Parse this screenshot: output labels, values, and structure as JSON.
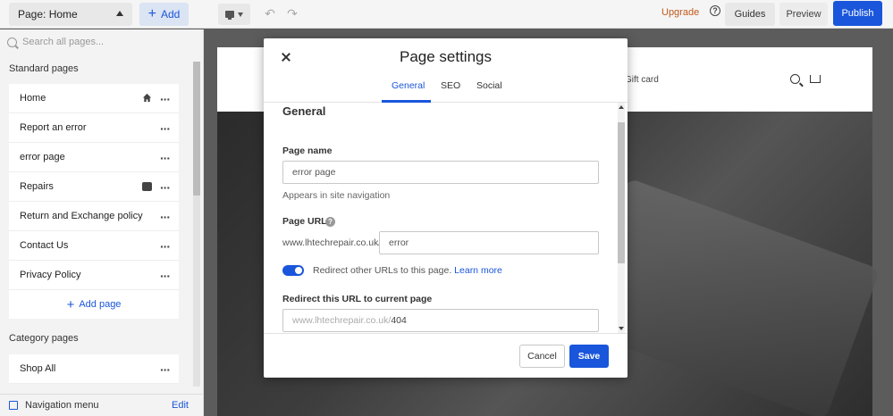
{
  "topbar": {
    "page_select": "Page: Home",
    "add_label": "Add",
    "upgrade": "Upgrade",
    "guides": "Guides",
    "preview": "Preview",
    "publish": "Publish"
  },
  "sidebar": {
    "search_placeholder": "Search all pages...",
    "standard_title": "Standard pages",
    "pages": [
      {
        "label": "Home",
        "icon": "home-icon"
      },
      {
        "label": "Report an error"
      },
      {
        "label": "error page"
      },
      {
        "label": "Repairs",
        "icon": "lock-icon"
      },
      {
        "label": "Return and Exchange policy"
      },
      {
        "label": "Contact Us"
      },
      {
        "label": "Privacy Policy"
      }
    ],
    "add_page": "Add page",
    "category_title": "Category pages",
    "category_pages": [
      {
        "label": "Shop All"
      }
    ],
    "nav_menu": "Navigation menu",
    "edit": "Edit"
  },
  "canvas": {
    "giftcard": "Gift card"
  },
  "modal": {
    "title": "Page settings",
    "tabs": [
      "General",
      "SEO",
      "Social"
    ],
    "active_tab": "General",
    "section": "General",
    "page_name_label": "Page name",
    "page_name_value": "error page",
    "page_name_helper": "Appears in site navigation",
    "page_url_label": "Page URL",
    "url_prefix": "www.lhtechrepair.co.uk/",
    "url_value": "error",
    "redirect_toggle_text": "Redirect other URLs to this page.",
    "learn_more": "Learn more",
    "redirect_label": "Redirect this URL to current page",
    "redirect_placeholder": "www.lhtechrepair.co.uk/",
    "redirect_value": "404",
    "cancel": "Cancel",
    "save": "Save"
  },
  "colors": {
    "accent": "#1a56db",
    "upgrade": "#c05a1a"
  }
}
